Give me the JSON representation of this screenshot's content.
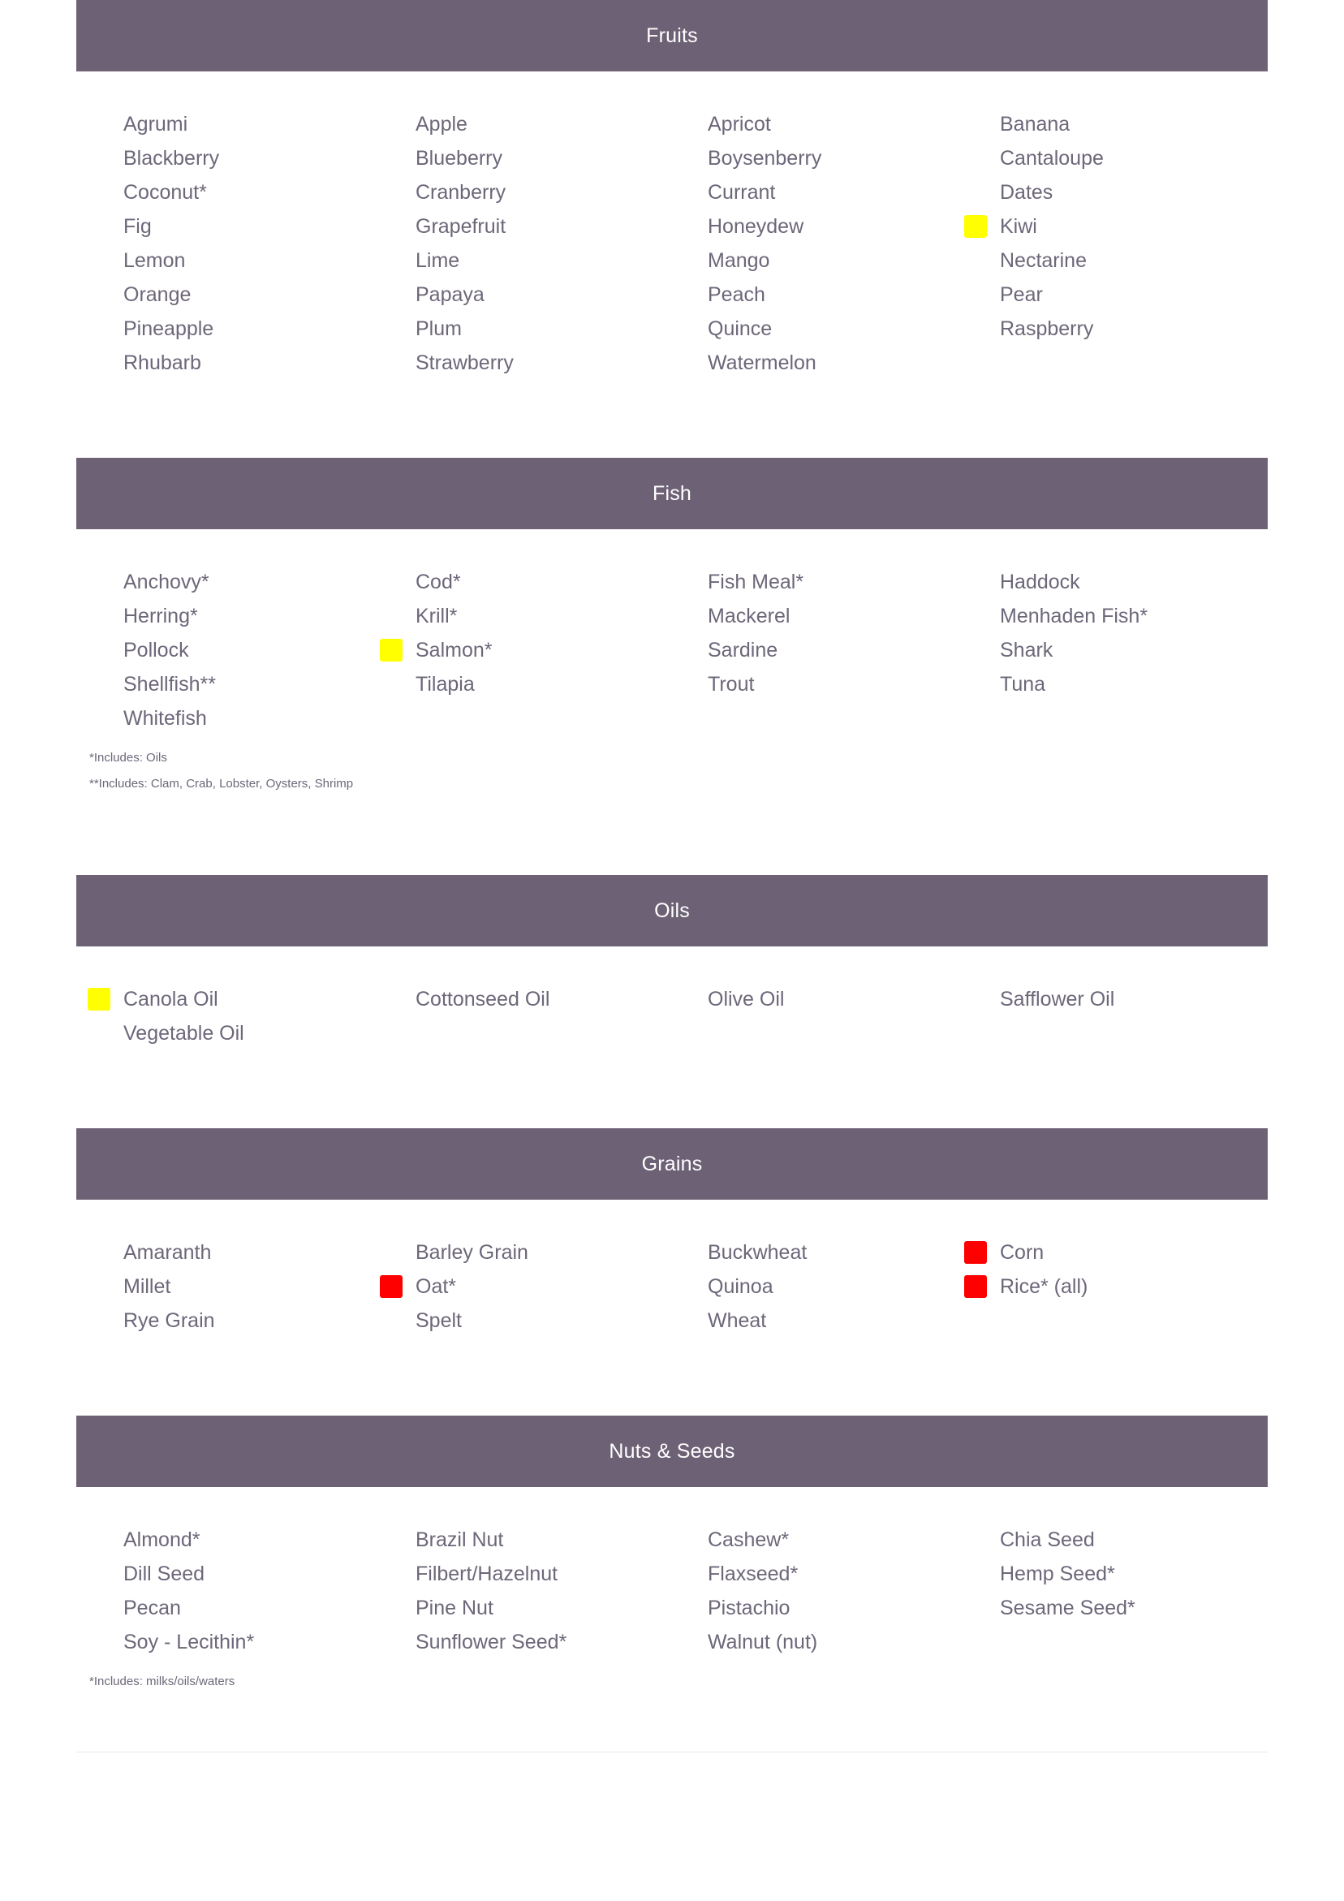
{
  "colors": {
    "header_bg": "#6d6275",
    "header_text": "#ffffff",
    "body_text": "#6d6779",
    "marker_yellow": "#ffff00",
    "marker_red": "#fe0000",
    "page_bg": "#ffffff"
  },
  "sections": [
    {
      "id": "fruits",
      "title": "Fruits",
      "columns": 4,
      "items": [
        {
          "label": "Agrumi",
          "marker": null
        },
        {
          "label": "Apple",
          "marker": null
        },
        {
          "label": "Apricot",
          "marker": null
        },
        {
          "label": "Banana",
          "marker": null
        },
        {
          "label": "Blackberry",
          "marker": null
        },
        {
          "label": "Blueberry",
          "marker": null
        },
        {
          "label": "Boysenberry",
          "marker": null
        },
        {
          "label": "Cantaloupe",
          "marker": null
        },
        {
          "label": "Coconut*",
          "marker": null
        },
        {
          "label": "Cranberry",
          "marker": null
        },
        {
          "label": "Currant",
          "marker": null
        },
        {
          "label": "Dates",
          "marker": null
        },
        {
          "label": "Fig",
          "marker": null
        },
        {
          "label": "Grapefruit",
          "marker": null
        },
        {
          "label": "Honeydew",
          "marker": null
        },
        {
          "label": "Kiwi",
          "marker": "yellow"
        },
        {
          "label": "Lemon",
          "marker": null
        },
        {
          "label": "Lime",
          "marker": null
        },
        {
          "label": "Mango",
          "marker": null
        },
        {
          "label": "Nectarine",
          "marker": null
        },
        {
          "label": "Orange",
          "marker": null
        },
        {
          "label": "Papaya",
          "marker": null
        },
        {
          "label": "Peach",
          "marker": null
        },
        {
          "label": "Pear",
          "marker": null
        },
        {
          "label": "Pineapple",
          "marker": null
        },
        {
          "label": "Plum",
          "marker": null
        },
        {
          "label": "Quince",
          "marker": null
        },
        {
          "label": "Raspberry",
          "marker": null
        },
        {
          "label": "Rhubarb",
          "marker": null
        },
        {
          "label": "Strawberry",
          "marker": null
        },
        {
          "label": "Watermelon",
          "marker": null
        },
        {
          "label": "",
          "marker": null
        }
      ],
      "notes": []
    },
    {
      "id": "fish",
      "title": "Fish",
      "columns": 4,
      "items": [
        {
          "label": "Anchovy*",
          "marker": null
        },
        {
          "label": "Cod*",
          "marker": null
        },
        {
          "label": "Fish Meal*",
          "marker": null
        },
        {
          "label": "Haddock",
          "marker": null
        },
        {
          "label": "Herring*",
          "marker": null
        },
        {
          "label": "Krill*",
          "marker": null
        },
        {
          "label": "Mackerel",
          "marker": null
        },
        {
          "label": "Menhaden Fish*",
          "marker": null
        },
        {
          "label": "Pollock",
          "marker": null
        },
        {
          "label": "Salmon*",
          "marker": "yellow"
        },
        {
          "label": "Sardine",
          "marker": null
        },
        {
          "label": "Shark",
          "marker": null
        },
        {
          "label": "Shellfish**",
          "marker": null
        },
        {
          "label": "Tilapia",
          "marker": null
        },
        {
          "label": "Trout",
          "marker": null
        },
        {
          "label": "Tuna",
          "marker": null
        },
        {
          "label": "Whitefish",
          "marker": null
        },
        {
          "label": "",
          "marker": null
        },
        {
          "label": "",
          "marker": null
        },
        {
          "label": "",
          "marker": null
        }
      ],
      "notes": [
        "*Includes: Oils",
        "**Includes: Clam, Crab, Lobster, Oysters, Shrimp"
      ]
    },
    {
      "id": "oils",
      "title": "Oils",
      "columns": 4,
      "items": [
        {
          "label": "Canola Oil",
          "marker": "yellow"
        },
        {
          "label": "Cottonseed Oil",
          "marker": null
        },
        {
          "label": "Olive Oil",
          "marker": null
        },
        {
          "label": "Safflower Oil",
          "marker": null
        },
        {
          "label": "Vegetable Oil",
          "marker": null
        },
        {
          "label": "",
          "marker": null
        },
        {
          "label": "",
          "marker": null
        },
        {
          "label": "",
          "marker": null
        }
      ],
      "notes": []
    },
    {
      "id": "grains",
      "title": "Grains",
      "columns": 4,
      "items": [
        {
          "label": "Amaranth",
          "marker": null
        },
        {
          "label": "Barley Grain",
          "marker": null
        },
        {
          "label": "Buckwheat",
          "marker": null
        },
        {
          "label": "Corn",
          "marker": "red"
        },
        {
          "label": "Millet",
          "marker": null
        },
        {
          "label": "Oat*",
          "marker": "red"
        },
        {
          "label": "Quinoa",
          "marker": null
        },
        {
          "label": "Rice* (all)",
          "marker": "red"
        },
        {
          "label": "Rye Grain",
          "marker": null
        },
        {
          "label": "Spelt",
          "marker": null
        },
        {
          "label": "Wheat",
          "marker": null
        },
        {
          "label": "",
          "marker": null
        }
      ],
      "notes": []
    },
    {
      "id": "nuts-and-seeds",
      "title": "Nuts & Seeds",
      "columns": 4,
      "items": [
        {
          "label": "Almond*",
          "marker": null
        },
        {
          "label": "Brazil Nut",
          "marker": null
        },
        {
          "label": "Cashew*",
          "marker": null
        },
        {
          "label": "Chia Seed",
          "marker": null
        },
        {
          "label": "Dill Seed",
          "marker": null
        },
        {
          "label": "Filbert/Hazelnut",
          "marker": null
        },
        {
          "label": "Flaxseed*",
          "marker": null
        },
        {
          "label": "Hemp Seed*",
          "marker": null
        },
        {
          "label": "Pecan",
          "marker": null
        },
        {
          "label": "Pine Nut",
          "marker": null
        },
        {
          "label": "Pistachio",
          "marker": null
        },
        {
          "label": "Sesame Seed*",
          "marker": null
        },
        {
          "label": "Soy - Lecithin*",
          "marker": null
        },
        {
          "label": "Sunflower Seed*",
          "marker": null
        },
        {
          "label": "Walnut (nut)",
          "marker": null
        },
        {
          "label": "",
          "marker": null
        }
      ],
      "notes": [
        "*Includes: milks/oils/waters"
      ]
    }
  ]
}
